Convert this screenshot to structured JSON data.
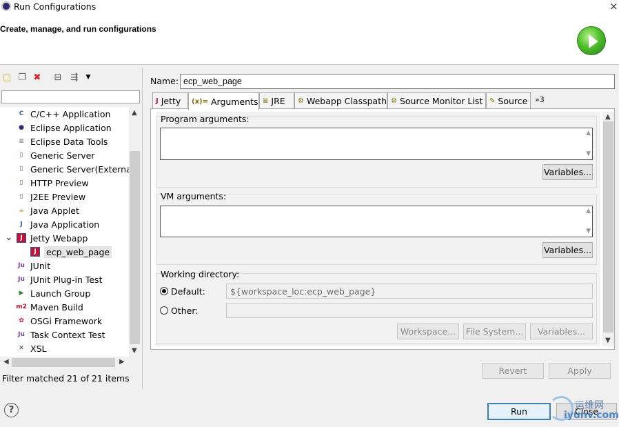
{
  "window": {
    "title": "Run Configurations",
    "close_glyph": "×"
  },
  "banner": {
    "heading": "Create, manage, and run configurations",
    "icon": "run-icon"
  },
  "left": {
    "toolbar": [
      "new-config-icon",
      "duplicate-icon",
      "delete-icon",
      "collapse-all-icon",
      "filter-icon"
    ],
    "filter_placeholder": "",
    "tree": [
      {
        "label": "C/C++ Application",
        "icon": "C"
      },
      {
        "label": "Eclipse Application",
        "icon": "●"
      },
      {
        "label": "Eclipse Data Tools",
        "icon": "≡"
      },
      {
        "label": "Generic Server",
        "icon": "▯"
      },
      {
        "label": "Generic Server(External l",
        "icon": "▯"
      },
      {
        "label": "HTTP Preview",
        "icon": "▯"
      },
      {
        "label": "J2EE Preview",
        "icon": "▯"
      },
      {
        "label": "Java Applet",
        "icon": "☕"
      },
      {
        "label": "Java Application",
        "icon": "J"
      },
      {
        "label": "Jetty Webapp",
        "icon": "J"
      },
      {
        "label": "ecp_web_page",
        "icon": "J"
      },
      {
        "label": "JUnit",
        "icon": "Ju"
      },
      {
        "label": "JUnit Plug-in Test",
        "icon": "Ju"
      },
      {
        "label": "Launch Group",
        "icon": "▶"
      },
      {
        "label": "Maven Build",
        "icon": "m2"
      },
      {
        "label": "OSGi Framework",
        "icon": "✿"
      },
      {
        "label": "Task Context Test",
        "icon": "Ju"
      },
      {
        "label": "XSL",
        "icon": "✕"
      }
    ],
    "status": "Filter matched 21 of 21 items"
  },
  "right": {
    "name_label": "Name:",
    "name_value": "ecp_web_page",
    "tabs": [
      {
        "label": "Jetty",
        "icon": "J"
      },
      {
        "label": "Arguments",
        "icon": "(x)="
      },
      {
        "label": "JRE",
        "icon": "≡"
      },
      {
        "label": "Webapp Classpath",
        "icon": "⚙"
      },
      {
        "label": "Source Monitor List",
        "icon": "⚙"
      },
      {
        "label": "Source",
        "icon": "✎"
      }
    ],
    "overflow": "»3",
    "program_args": {
      "label": "Program arguments:",
      "value": "",
      "variables": "Variables..."
    },
    "vm_args": {
      "label": "VM arguments:",
      "value": "",
      "variables": "Variables..."
    },
    "working_dir": {
      "label": "Working directory:",
      "default_label": "Default:",
      "default_value": "${workspace_loc:ecp_web_page}",
      "other_label": "Other:",
      "other_value": "",
      "workspace_btn": "Workspace...",
      "filesystem_btn": "File System...",
      "variables_btn": "Variables..."
    },
    "revert": "Revert",
    "apply": "Apply"
  },
  "footer": {
    "help": "?",
    "run": "Run",
    "close": "Close"
  },
  "watermark": {
    "line1": "运维网",
    "line2": "iyunv.com"
  }
}
